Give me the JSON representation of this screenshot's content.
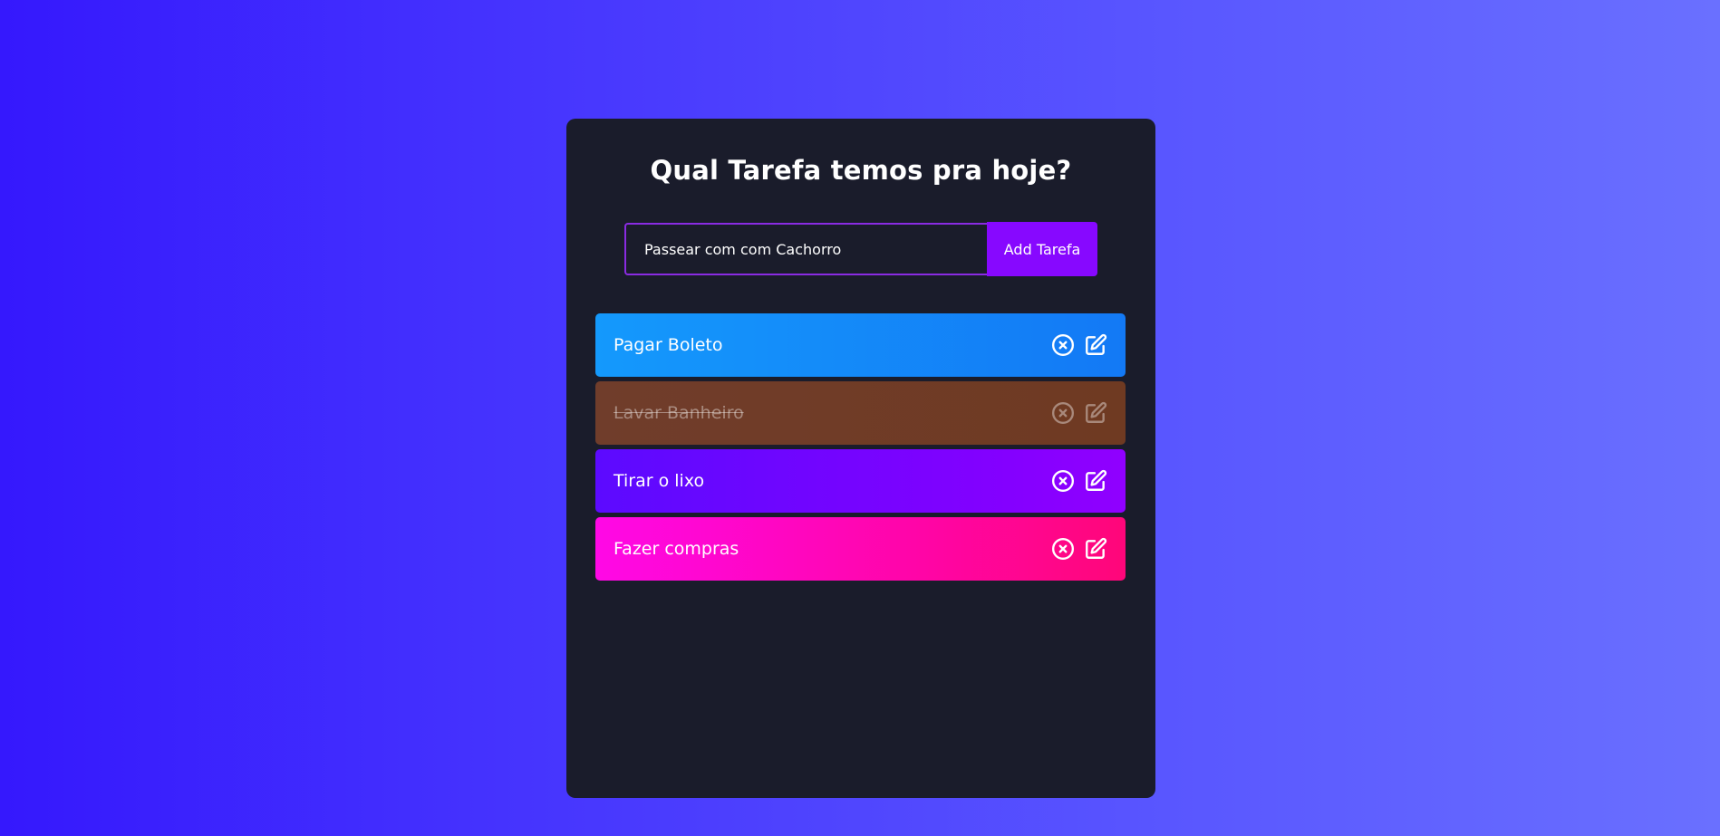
{
  "app": {
    "title": "Qual Tarefa temos pra hoje?"
  },
  "form": {
    "input_value": "Passear com com Cachorro",
    "add_button_label": "Add Tarefa"
  },
  "todos": [
    {
      "text": "Pagar Boleto",
      "complete": false,
      "colors": [
        "#1499fc",
        "#1379f5"
      ]
    },
    {
      "text": "Lavar Banheiro",
      "complete": true,
      "colors": [
        "#703d2b",
        "#6f3a22"
      ]
    },
    {
      "text": "Tirar o lixo",
      "complete": false,
      "colors": [
        "#5c0aff",
        "#9000ff"
      ]
    },
    {
      "text": "Fazer compras",
      "complete": false,
      "colors": [
        "#ff08e6",
        "#ff0679"
      ]
    }
  ],
  "icons": {
    "delete": "close-circle-icon",
    "edit": "edit-icon"
  },
  "colors": {
    "background_start": "#3518fd",
    "background_end": "#6a70ff",
    "card": "#1a1c2b",
    "accent": "#8708ff"
  }
}
